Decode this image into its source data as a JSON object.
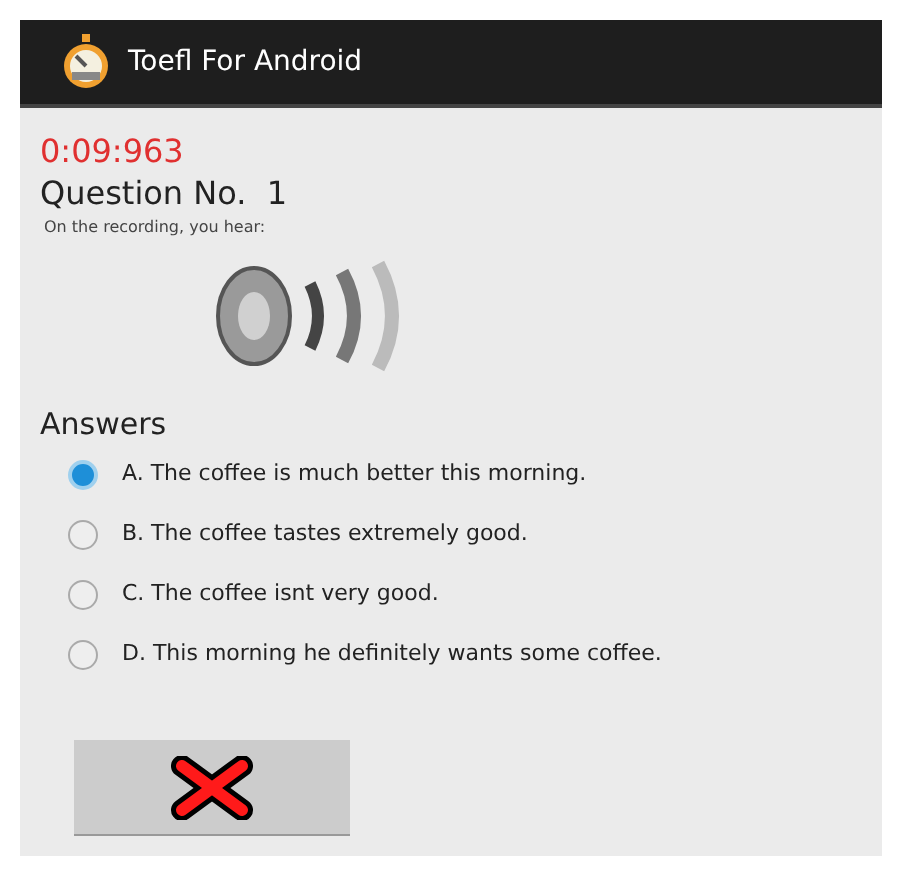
{
  "app_bar": {
    "title": "Toefl For Android"
  },
  "timer": "0:09:963",
  "question": {
    "title": "Question No.  1",
    "prompt": "On the recording, you hear:"
  },
  "answers": {
    "heading": "Answers",
    "options": [
      {
        "label": "A. The coffee is much better this morning.",
        "selected": true
      },
      {
        "label": "B. The coffee tastes extremely good.",
        "selected": false
      },
      {
        "label": "C. The coffee isnt very good.",
        "selected": false
      },
      {
        "label": "D. This morning he definitely wants some coffee.",
        "selected": false
      }
    ]
  }
}
